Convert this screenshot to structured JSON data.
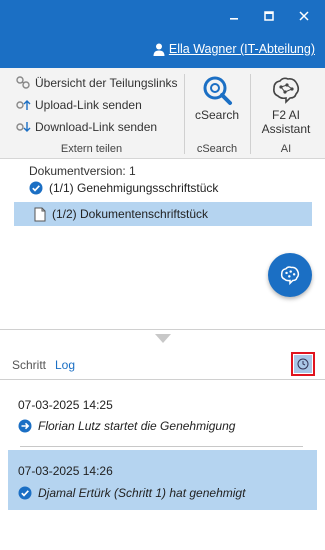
{
  "titlebar": {
    "user_name": "Ella Wagner (IT-Abteilung)",
    "accent": "#1b6fc4"
  },
  "ribbon": {
    "extern": {
      "group_label": "Extern teilen",
      "items": [
        {
          "label": "Übersicht der Teilungslinks",
          "icon": "share-links-icon"
        },
        {
          "label": "Upload-Link senden",
          "icon": "upload-link-icon"
        },
        {
          "label": "Download-Link senden",
          "icon": "download-link-icon"
        }
      ]
    },
    "csearch": {
      "button_label": "cSearch",
      "group_label": "cSearch",
      "icon": "csearch-icon"
    },
    "ai": {
      "button_label_line1": "F2 AI",
      "button_label_line2": "Assistant",
      "group_label": "AI",
      "icon": "brain-icon"
    }
  },
  "documents": {
    "version_label": "Dokumentversion: 1",
    "items": [
      {
        "label": "(1/1) Genehmigungsschriftstück",
        "icon": "approved-check-icon",
        "selected": false
      },
      {
        "label": "(1/2) Dokumentenschriftstück",
        "icon": "document-icon",
        "selected": true
      }
    ]
  },
  "tabs": {
    "schritt": "Schritt",
    "log": "Log",
    "active": "Log"
  },
  "log": [
    {
      "timestamp": "07-03-2025 14:25",
      "message": "Florian Lutz startet die Genehmigung",
      "icon": "arrow-right-circle-icon",
      "selected": false
    },
    {
      "timestamp": "07-03-2025 14:26",
      "message": "Djamal Ertürk (Schritt 1) hat genehmigt",
      "icon": "check-circle-icon",
      "selected": true
    }
  ]
}
